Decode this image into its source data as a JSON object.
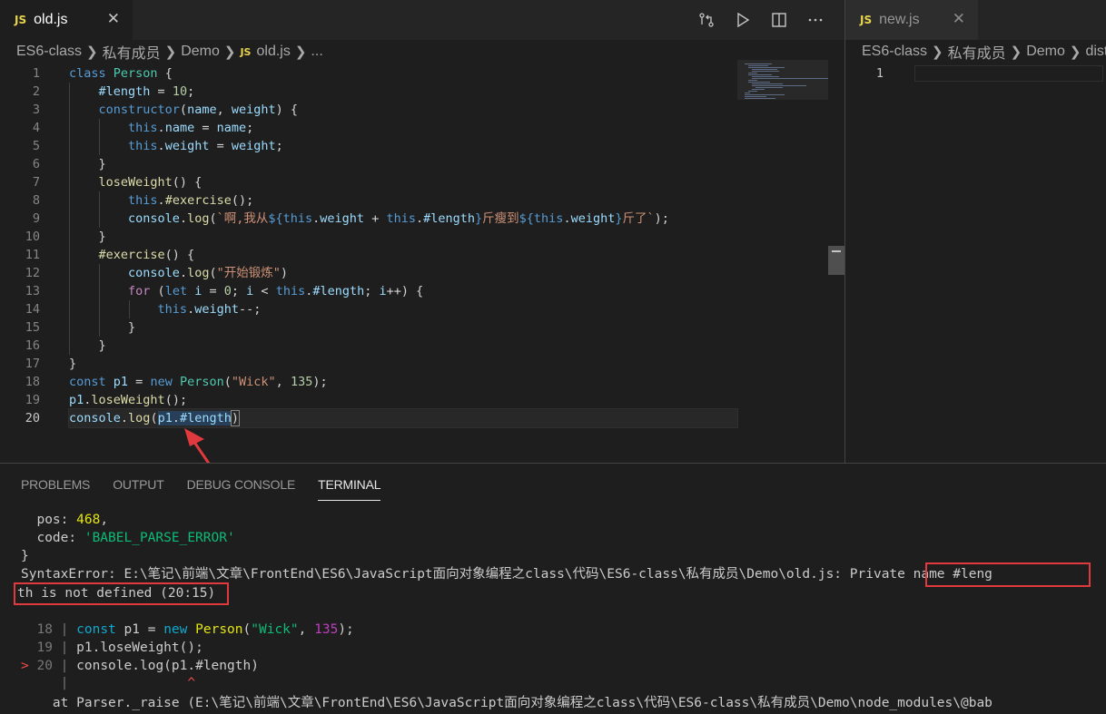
{
  "left_editor": {
    "tab_icon": "JS",
    "tab_label": "old.js",
    "breadcrumb": [
      "ES6-class",
      "私有成员",
      "Demo"
    ],
    "breadcrumb_file_icon": "JS",
    "breadcrumb_file": "old.js",
    "breadcrumb_tail": "...",
    "actions": [
      "compare-changes-icon",
      "run-icon",
      "split-editor-icon",
      "more-actions-icon"
    ],
    "line_numbers": [
      "1",
      "2",
      "3",
      "4",
      "5",
      "6",
      "7",
      "8",
      "9",
      "10",
      "11",
      "12",
      "13",
      "14",
      "15",
      "16",
      "17",
      "18",
      "19",
      "20"
    ]
  },
  "right_editor": {
    "tab_icon": "JS",
    "tab_label": "new.js",
    "breadcrumb": [
      "ES6-class",
      "私有成员",
      "Demo",
      "dist"
    ],
    "line_numbers": [
      "1"
    ]
  },
  "panel": {
    "tabs": [
      "PROBLEMS",
      "OUTPUT",
      "DEBUG CONSOLE",
      "TERMINAL"
    ],
    "active_tab": "TERMINAL"
  },
  "terminal": {
    "pos_key": "  pos: ",
    "pos_val": "468",
    "pos_comma": ",",
    "code_key": "  code: ",
    "code_val": "'BABEL_PARSE_ERROR'",
    "close_brace": "}",
    "error_prefix": "SyntaxError: E:\\笔记\\前端\\文章\\FrontEnd\\ES6\\JavaScript面向对象编程之class\\代码\\ES6-class\\私有成员\\Demo\\old.js: ",
    "error_msg_1": "Private name #leng",
    "error_msg_2": "th is not defined (20:15)",
    "snippet": [
      {
        "marker": "  ",
        "num": "18",
        "sep": " | "
      },
      {
        "marker": "  ",
        "num": "19",
        "sep": " | "
      },
      {
        "marker": "> ",
        "num": "20",
        "sep": " | "
      }
    ],
    "snippet_caret_sep": " | ",
    "snippet_caret": "^",
    "at_line": "    at Parser._raise (E:\\笔记\\前端\\文章\\FrontEnd\\ES6\\JavaScript面向对象编程之class\\代码\\ES6-class\\私有成员\\Demo\\node_modules\\@bab"
  },
  "colors": {
    "editor_bg": "#1e1e1e",
    "keyword": "#569cd6",
    "string": "#ce9178",
    "annotation_red": "#e0393e"
  }
}
